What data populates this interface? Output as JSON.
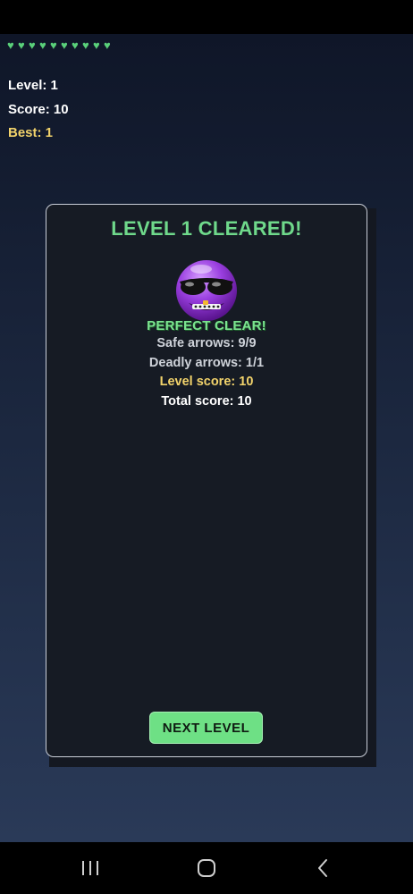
{
  "hud": {
    "hearts_count": 10,
    "heart_icon": "heart-icon",
    "heart_color": "#5ad07a",
    "level_text": "Level: 1",
    "score_text": "Score: 10",
    "best_text": "Best: 1"
  },
  "panel": {
    "title": "LEVEL 1 CLEARED!",
    "mascot_icon": "purple-smiley-sunglasses-icon",
    "perfect_text": "PERFECT CLEAR!",
    "safe_arrows": "Safe arrows: 9/9",
    "deadly_arrows": "Deadly arrows: 1/1",
    "level_score": "Level score: 10",
    "total_score": "Total score: 10",
    "next_button": "NEXT LEVEL"
  },
  "colors": {
    "accent_green": "#6ee085",
    "gold": "#f2d36b"
  },
  "nav": {
    "recent_icon": "recent-apps-icon",
    "home_icon": "home-icon",
    "back_icon": "back-icon"
  }
}
